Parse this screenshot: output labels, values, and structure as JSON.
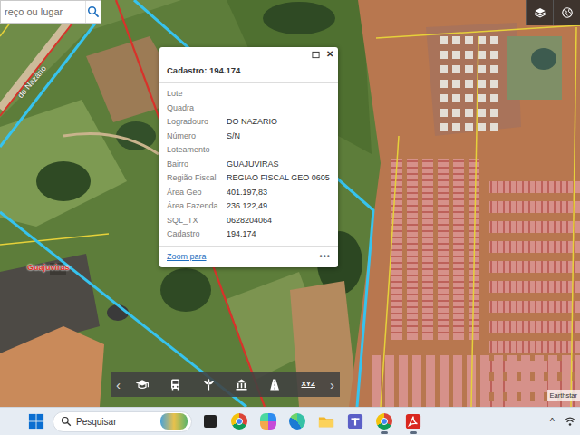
{
  "search": {
    "placeholder": "reço ou lugar"
  },
  "map_labels": [
    {
      "text": "Guajuviras",
      "kind": "place"
    },
    {
      "text": "do Nazário",
      "kind": "street"
    }
  ],
  "map_controls": [
    {
      "kind": "layers"
    },
    {
      "kind": "basemap"
    }
  ],
  "popup": {
    "close": "✕",
    "title": "Cadastro: 194.174",
    "fields": [
      {
        "label": "Lote",
        "value": ""
      },
      {
        "label": "Quadra",
        "value": ""
      },
      {
        "label": "Logradouro",
        "value": "DO NAZARIO"
      },
      {
        "label": "Número",
        "value": "S/N"
      },
      {
        "label": "Loteamento",
        "value": ""
      },
      {
        "label": "Bairro",
        "value": "GUAJUVIRAS"
      },
      {
        "label": "Região Fiscal",
        "value": "REGIAO FISCAL GEO 0605"
      },
      {
        "label": "Área Geo",
        "value": "401.197,83"
      },
      {
        "label": "Área Fazenda",
        "value": "236.122,49"
      },
      {
        "label": "SQL_TX",
        "value": "0628204064"
      },
      {
        "label": "Cadastro",
        "value": "194.174"
      }
    ],
    "zoom_link": "Zoom para",
    "more": "•••"
  },
  "toolbar": {
    "prev": "‹",
    "next": "›",
    "tools": [
      {
        "kind": "school"
      },
      {
        "kind": "bus"
      },
      {
        "kind": "plant"
      },
      {
        "kind": "bank"
      },
      {
        "kind": "road"
      },
      {
        "kind": "text",
        "label": "XYZ"
      }
    ]
  },
  "attribution": "Earthstar",
  "taskbar": {
    "search_placeholder": "Pesquisar",
    "apps": [
      {
        "kind": "taskview",
        "open": false
      },
      {
        "kind": "chrome",
        "open": false
      },
      {
        "kind": "copilot",
        "open": false
      },
      {
        "kind": "edge",
        "open": false
      },
      {
        "kind": "explorer",
        "open": false
      },
      {
        "kind": "teams",
        "open": false
      },
      {
        "kind": "chrome",
        "open": true
      },
      {
        "kind": "pdf",
        "open": true
      }
    ],
    "tray_arrow": "^"
  }
}
